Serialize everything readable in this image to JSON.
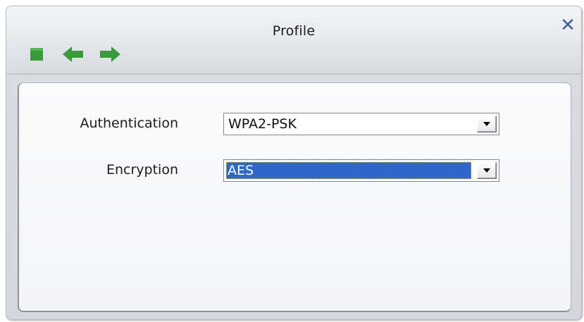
{
  "window": {
    "title": "Profile",
    "close_label": "✕"
  },
  "toolbar": {
    "buttons": [
      {
        "icon": "stop-icon",
        "color": "#3a9a3a"
      },
      {
        "icon": "back-arrow-icon",
        "color": "#3a9a3a"
      },
      {
        "icon": "forward-arrow-icon",
        "color": "#3a9a3a"
      }
    ]
  },
  "form": {
    "authentication": {
      "label": "Authentication",
      "value": "WPA2-PSK"
    },
    "encryption": {
      "label": "Encryption",
      "value": "AES",
      "focused": true
    }
  },
  "colors": {
    "selection": "#2f66c9",
    "close": "#3f5d93"
  }
}
